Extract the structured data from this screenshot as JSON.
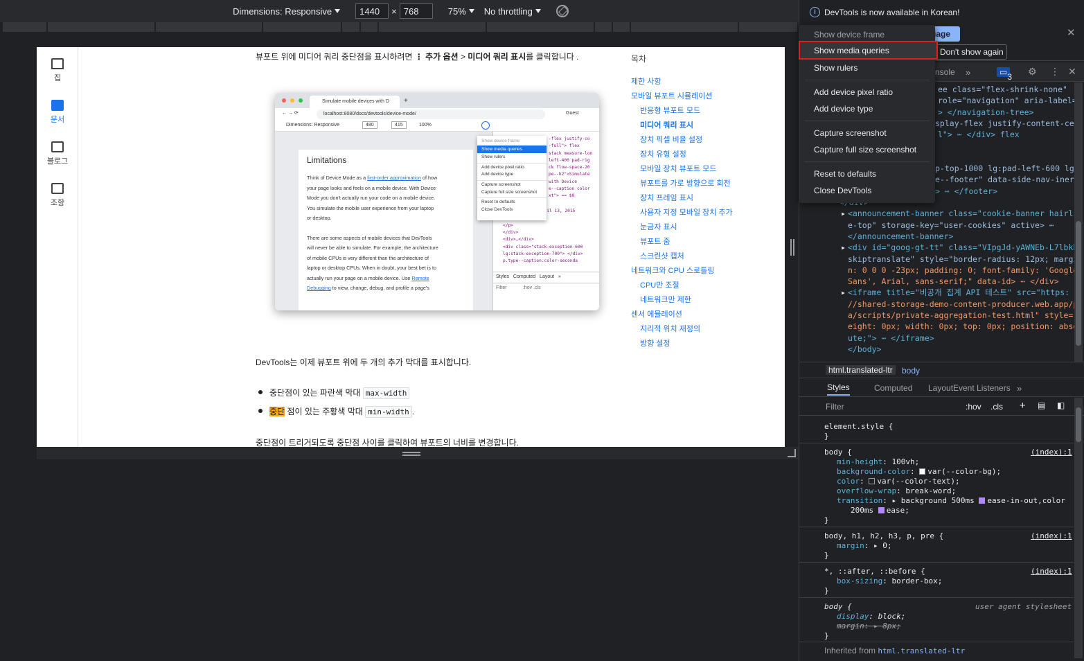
{
  "device_toolbar": {
    "dimensions_label": "Dimensions: Responsive",
    "width": "1440",
    "height": "768",
    "times": "×",
    "zoom": "75%",
    "throttling": "No throttling"
  },
  "left_nav": [
    {
      "label": "집",
      "icon": "home-icon"
    },
    {
      "label": "문서",
      "icon": "docs-icon",
      "active": true
    },
    {
      "label": "블로그",
      "icon": "blog-icon"
    },
    {
      "label": "조항",
      "icon": "articles-icon"
    }
  ],
  "article": {
    "intro_a": "뷰포트 위에 미디어 쿼리 중단점을 표시하려면 ",
    "intro_kebab": "⋮",
    "intro_b": " 추가 옵션",
    "intro_gt": " > ",
    "intro_c": "미디어 쿼리 표시",
    "intro_d": "를 클릭합니다 .",
    "devtools_bars": "DevTools는 이제 뷰포트 위에 두 개의 추가 막대를 표시합니다.",
    "bullet1_text": "중단점이 있는 파란색 막대 ",
    "bullet1_code": "max-width",
    "bullet2_hl": "중단",
    "bullet2_text": " 점이 있는 주황색 막대 ",
    "bullet2_code": "min-width",
    "bullet2_end": ".",
    "bottom": "중단점이 트리거되도록 중단점 사이를 클릭하여 뷰포트의 너비를 변경합니다."
  },
  "embedded": {
    "tab_title": "Simulate mobile devices with D",
    "url": "localhost:8080/docs/devtools/device-mode/",
    "guest": "Guest",
    "dims": "Dimensions: Responsive",
    "w": "480",
    "h": "415",
    "zoom": "100%",
    "heading": "Limitations",
    "para1": [
      "Think of Device Mode as a ",
      "first-order approximation",
      " of how",
      "your page looks and feels on a mobile device. With Device",
      "Mode you don't actually run your code on a mobile device.",
      "You simulate the mobile user experience from your laptop",
      "or desktop."
    ],
    "para2": [
      "There are some aspects of mobile devices that DevTools",
      "will never be able to simulate. For example, the architecture",
      "of mobile CPUs is very different than the architecture of",
      "laptop or desktop CPUs. When in doubt, your best bet is to",
      "actually run your page on a mobile device. Use ",
      "Remote",
      "Debugging",
      " to view, change, debug, and profile a page's"
    ],
    "menu": [
      "Show device frame",
      "Show media queries",
      "Show rulers",
      "Add device pixel ratio",
      "Add device type",
      "Capture screenshot",
      "Capture full size screenshot",
      "Reset to defaults",
      "Close DevTools"
    ],
    "code_lines": [
      "-flex justify-co",
      "-full\"> flex",
      "stack measure-lon",
      "left-400 pad-rig",
      "ck flow-space-20",
      "pe--h2\">Simulate",
      " with Device",
      "e--caption color",
      "xt\"> == $0",
      "Published on \"",
      "<time>Monday, April 13, 2015",
      "</time>",
      "</p>",
      "</div>",
      "<div>…</div>",
      "<div class=\"stack-exception-600",
      " lg:stack-exception-700\"> </div>",
      "p.type--caption.color-seconda"
    ],
    "tabs": [
      "Styles",
      "Computed",
      "Layout",
      "»"
    ],
    "filter": "Filter",
    "hov": ":hov",
    "cls": ".cls"
  },
  "toc": {
    "title": "목차",
    "entries": [
      {
        "label": "제한 사항",
        "level": 0
      },
      {
        "label": "모바일 뷰포트 시뮬레이션",
        "level": 0
      },
      {
        "label": "반응형 뷰포트 모드",
        "level": 1
      },
      {
        "label": "미디어 쿼리 표시",
        "level": 1,
        "current": true
      },
      {
        "label": "장치 픽셀 비율 설정",
        "level": 1
      },
      {
        "label": "장치 유형 설정",
        "level": 1
      },
      {
        "label": "모바일 장치 뷰포트 모드",
        "level": 1
      },
      {
        "label": "뷰포트를 가로 방향으로 회전",
        "level": 1
      },
      {
        "label": "장치 프레임 표시",
        "level": 1
      },
      {
        "label": "사용자 지정 모바일 장치 추가",
        "level": 1
      },
      {
        "label": "눈금자 표시",
        "level": 1
      },
      {
        "label": "뷰포트 줌",
        "level": 1
      },
      {
        "label": "스크린샷 캡처",
        "level": 1
      },
      {
        "label": "네트워크와 CPU 스로틀링",
        "level": 0
      },
      {
        "label": "CPU만 조절",
        "level": 1
      },
      {
        "label": "네트워크만 제한",
        "level": 1
      },
      {
        "label": "센서 에뮬레이션",
        "level": 0
      },
      {
        "label": "지리적 위치 재정의",
        "level": 1
      },
      {
        "label": "방향 설정",
        "level": 1
      }
    ]
  },
  "devtools": {
    "banner_text": "DevTools is now available in Korean!",
    "lang_button": "uage",
    "dont_show": "Don't show again",
    "tab_console": "nsole",
    "badge": "3",
    "elements_lines": [
      {
        "t": "ee class=\"flex-shrink-none\"",
        "c": "attr"
      },
      {
        "t": "role=\"navigation\" aria-label=",
        "c": "attr"
      },
      {
        "t": "> </navigation-tree>",
        "c": "tag"
      },
      {
        "t": "splay-flex justify-content-ce",
        "c": "attr"
      },
      {
        "t": "l\"> ⋯ </div> flex",
        "c": "tag"
      },
      {
        "t": "",
        "c": "tag"
      },
      {
        "t": "",
        "c": "tag"
      },
      {
        "t": "p-top-1000 lg:pad-left-600 lg:",
        "c": "attr"
      },
      {
        "t": "e--footer\" data-side-nav-inert",
        "c": "attr"
      },
      {
        "t": "> ⋯ </footer>",
        "c": "tag"
      },
      {
        "t": "</div>",
        "c": "tag"
      },
      {
        "t": "<announcement-banner class=\"cookie-banner hairlin",
        "c": "tag"
      },
      {
        "t": "e-top\" storage-key=\"user-cookies\" active> ⋯",
        "c": "attr"
      },
      {
        "t": "</announcement-banner>",
        "c": "tag"
      },
      {
        "t": "<div id=\"goog-gt-tt\" class=\"VIpgJd-yAWNEb-L7lbkb",
        "c": "tag"
      },
      {
        "t": "skiptranslate\" style=\"border-radius: 12px; margi",
        "c": "attr"
      },
      {
        "t": "n: 0 0 0 -23px; padding: 0; font-family: 'Google",
        "c": "val"
      },
      {
        "t": "Sans', Arial, sans-serif;\" data-id> ⋯ </div>",
        "c": "val"
      },
      {
        "t": "<iframe title=\"비공개 집계 API 테스트\" src=\"https:",
        "c": "tag"
      },
      {
        "t": "//shared-storage-demo-content-producer.web.app/pa",
        "c": "val"
      },
      {
        "t": "a/scripts/private-aggregation-test.html\" style=\"h",
        "c": "val"
      },
      {
        "t": "eight: 0px; width: 0px; top: 0px; position: absol",
        "c": "val"
      },
      {
        "t": "ute;\"> ⋯ </iframe>",
        "c": "tag"
      },
      {
        "t": "</body>",
        "c": "tag"
      }
    ],
    "crumb1": "html.translated-ltr",
    "crumb2": "body",
    "subtabs": [
      "Styles",
      "Computed",
      "Layout",
      "Event Listeners",
      "»"
    ],
    "filter_placeholder": "Filter",
    "hov": ":hov",
    "cls": ".cls",
    "rules": [
      {
        "sel": "element.style {",
        "src": ""
      },
      {
        "sel": "body {",
        "src": "(index):1"
      },
      {
        "sel": "body, h1, h2, h3, p, pre {",
        "src": "(index):1"
      },
      {
        "sel": "*, ::after, ::before {",
        "src": "(index):1"
      },
      {
        "sel": "body {",
        "src": "user agent stylesheet"
      }
    ],
    "props": {
      "min_height": [
        "min-height",
        "100vh;"
      ],
      "bg": [
        "background-color",
        "var(--color-bg);"
      ],
      "color": [
        "color",
        "var(--color-text);"
      ],
      "wrap": [
        "overflow-wrap",
        "break-word;"
      ],
      "transition": [
        "transition",
        "background 500ms",
        "ease-in-out,color",
        "200ms",
        "ease;"
      ],
      "margin": [
        "margin",
        "0;"
      ],
      "boxsizing": [
        "box-sizing",
        "border-box;"
      ],
      "display": [
        "display",
        "block;"
      ],
      "margin8": [
        "margin",
        "8px;"
      ]
    },
    "inherited_from": "Inherited from ",
    "inherited_el": "html.translated-ltr"
  },
  "menu": {
    "items": [
      "Show device frame",
      "Show media queries",
      "Show rulers",
      "Add device pixel ratio",
      "Add device type",
      "Capture screenshot",
      "Capture full size screenshot",
      "Reset to defaults",
      "Close DevTools"
    ]
  },
  "colors": {
    "accent": "#8ab4f8",
    "highlight_red": "#e02020",
    "link": "#1a73e8"
  }
}
